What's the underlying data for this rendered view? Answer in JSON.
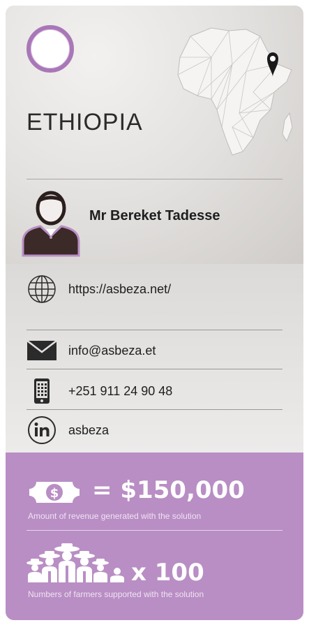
{
  "country": {
    "name": "ETHIOPIA"
  },
  "contact_person": {
    "name": "Mr Bereket Tadesse"
  },
  "contacts": {
    "website": "https://asbeza.net/",
    "email": "info@asbeza.et",
    "phone": "+251 911 24 90 48",
    "linkedin": "asbeza"
  },
  "stats": {
    "revenue": {
      "value": "= $150,000",
      "caption": "Amount of revenue generated with the solution",
      "icon": "money-icon"
    },
    "farmers": {
      "value": "x 100",
      "caption": "Numbers of farmers supported with the solution",
      "icon": "farmers-group-icon"
    }
  },
  "colors": {
    "accent_purple": "#a977b7",
    "panel_purple": "#b98ec4",
    "text_dark": "#1e1e1e"
  }
}
